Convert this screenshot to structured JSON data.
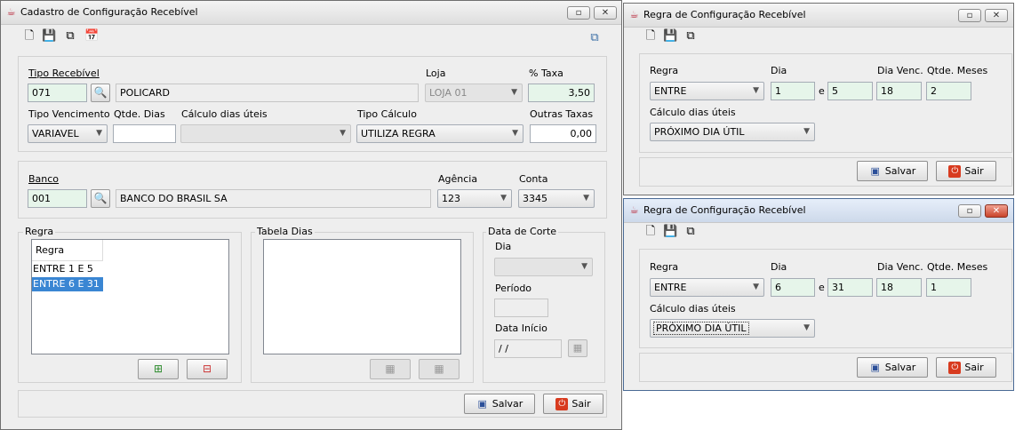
{
  "main": {
    "title": "Cadastro de Configuração Recebível",
    "fields": {
      "tipo_recebivel_label": "Tipo Recebível",
      "tipo_recebivel_code": "071",
      "tipo_recebivel_name": "POLICARD",
      "loja_label": "Loja",
      "loja_value": "LOJA 01",
      "taxa_label": "% Taxa",
      "taxa_value": "3,50",
      "tipo_venc_label": "Tipo Vencimento",
      "tipo_venc_value": "VARIAVEL",
      "qtde_dias_label": "Qtde. Dias",
      "qtde_dias_value": "",
      "calc_dias_label": "Cálculo dias úteis",
      "calc_dias_value": "",
      "tipo_calc_label": "Tipo Cálculo",
      "tipo_calc_value": "UTILIZA REGRA",
      "outras_taxas_label": "Outras Taxas",
      "outras_taxas_value": "0,00",
      "banco_label": "Banco",
      "banco_code": "001",
      "banco_name": "BANCO DO BRASIL SA",
      "agencia_label": "Agência",
      "agencia_value": "123",
      "conta_label": "Conta",
      "conta_value": "3345"
    },
    "regra_group": {
      "title": "Regra",
      "column_header": "Regra",
      "rows": [
        "ENTRE 1 E 5",
        "ENTRE 6 E 31"
      ],
      "selected_index": 1
    },
    "tabela_dias_group": {
      "title": "Tabela Dias"
    },
    "data_corte_group": {
      "title": "Data de Corte",
      "dia_label": "Dia",
      "periodo_label": "Período",
      "data_inicio_label": "Data Início",
      "data_inicio_value": " / /"
    },
    "buttons": {
      "save": "Salvar",
      "exit": "Sair"
    }
  },
  "regra_windows": [
    {
      "title": "Regra de Configuração Recebível",
      "regra_label": "Regra",
      "regra_value": "ENTRE",
      "dia_label": "Dia",
      "dia_from": "1",
      "e_label": "e",
      "dia_to": "5",
      "dia_venc_label": "Dia Venc.",
      "dia_venc_value": "18",
      "qtde_meses_label": "Qtde. Meses",
      "qtde_meses_value": "2",
      "calc_label": "Cálculo dias úteis",
      "calc_value": "PRÓXIMO DIA ÚTIL",
      "save": "Salvar",
      "exit": "Sair"
    },
    {
      "title": "Regra de Configuração Recebível",
      "regra_label": "Regra",
      "regra_value": "ENTRE",
      "dia_label": "Dia",
      "dia_from": "6",
      "e_label": "e",
      "dia_to": "31",
      "dia_venc_label": "Dia Venc.",
      "dia_venc_value": "18",
      "qtde_meses_label": "Qtde. Meses",
      "qtde_meses_value": "1",
      "calc_label": "Cálculo dias úteis",
      "calc_value": "PRÓXIMO DIA ÚTIL",
      "save": "Salvar",
      "exit": "Sair"
    }
  ]
}
